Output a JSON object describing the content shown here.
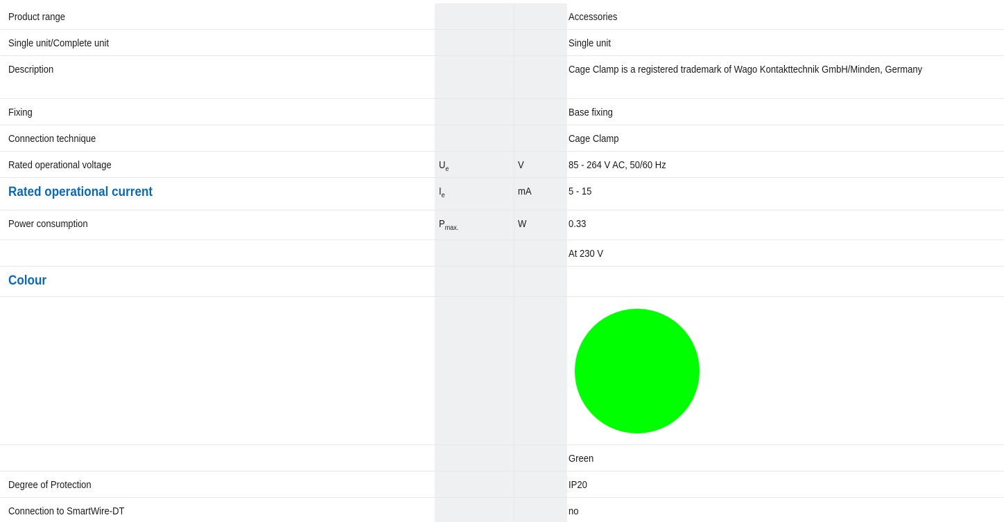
{
  "rows": {
    "product_range": {
      "label": "Product range",
      "value": "Accessories"
    },
    "single_unit": {
      "label": "Single unit/Complete unit",
      "value": "Single unit"
    },
    "description": {
      "label": "Description",
      "value": "Cage Clamp is a registered trademark of Wago Kontakttechnik GmbH/Minden, Germany"
    },
    "fixing": {
      "label": "Fixing",
      "value": "Base fixing"
    },
    "connection": {
      "label": "Connection technique",
      "value": "Cage Clamp"
    },
    "voltage": {
      "label": "Rated operational voltage",
      "sym": "U",
      "sub": "e",
      "unit": "V",
      "value": "85 - 264 V AC, 50/60 Hz"
    },
    "current": {
      "label": "Rated operational current",
      "sym": "I",
      "sub": "e",
      "unit": "mA",
      "value": "5 - 15"
    },
    "power": {
      "label": "Power consumption",
      "sym": "P",
      "sub": "max.",
      "unit": "W",
      "value": "0.33"
    },
    "power_note": {
      "value": "At 230 V"
    },
    "colour": {
      "label": "Colour"
    },
    "colour_value": {
      "value": "Green",
      "swatch_color": "#00ff00"
    },
    "protection": {
      "label": "Degree of Protection",
      "value": "IP20"
    },
    "smartwire": {
      "label": "Connection to SmartWire-DT",
      "value": "no"
    }
  }
}
